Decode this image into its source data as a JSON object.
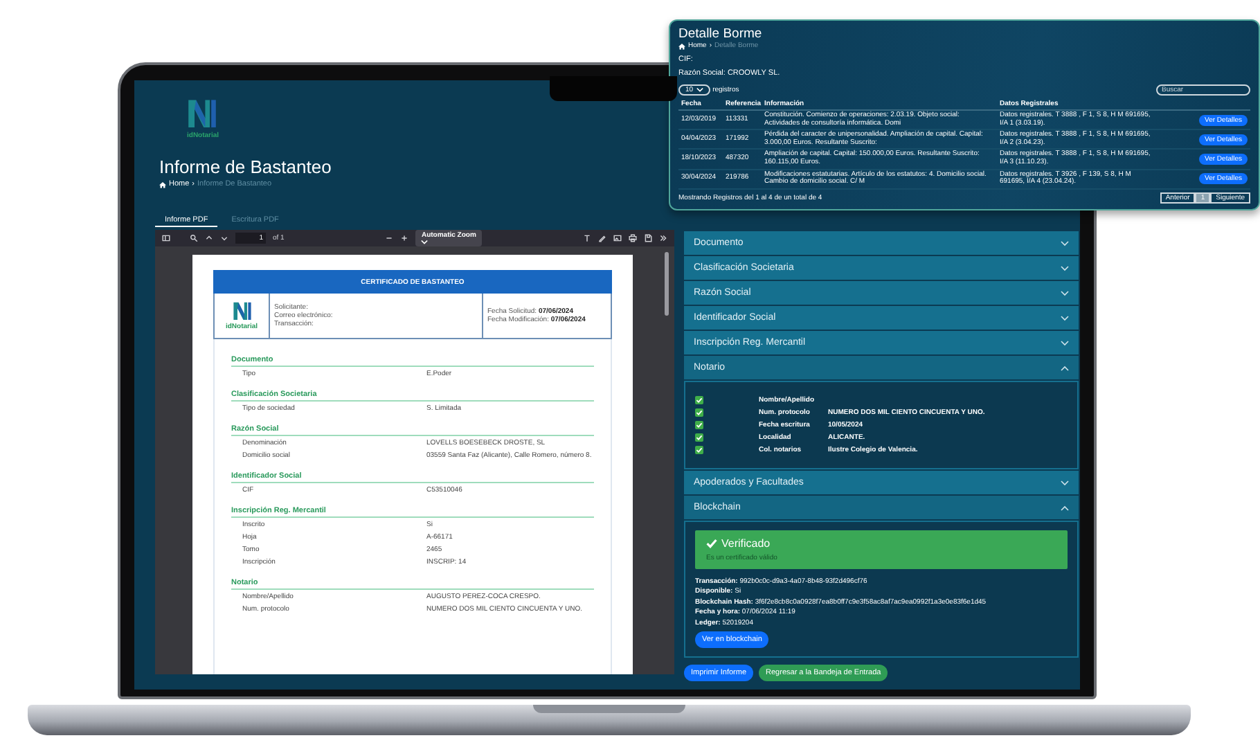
{
  "app": {
    "logo_text": "idNotarial",
    "title": "Informe de Bastanteo",
    "breadcrumb": {
      "home": "Home",
      "separator": "›",
      "current": "Informe De Bastanteo"
    },
    "tabs": [
      {
        "label": "Informe PDF",
        "selected": true
      },
      {
        "label": "Escritura PDF",
        "selected": false
      }
    ],
    "pdf_viewer": {
      "page": "1",
      "page_count": "of 1",
      "zoom": "Automatic Zoom",
      "document": {
        "heading": "CERTIFICADO DE BASTANTEO",
        "logo_text": "idNotarial",
        "fields": [
          "Solicitante:",
          "Correo electrónico:",
          "Transacción:"
        ],
        "dates": [
          {
            "label": "Fecha Solicitud:",
            "value": "07/06/2024"
          },
          {
            "label": "Fecha Modificación:",
            "value": "07/06/2024"
          }
        ],
        "sections": [
          {
            "title": "Documento",
            "rows": [
              {
                "label": "Tipo",
                "value": "E.Poder"
              }
            ]
          },
          {
            "title": "Clasificación Societaria",
            "rows": [
              {
                "label": "Tipo de sociedad",
                "value": "S. Limitada"
              }
            ]
          },
          {
            "title": "Razón Social",
            "rows": [
              {
                "label": "Denominación",
                "value": "LOVELLS BOESEBECK DROSTE, SL"
              },
              {
                "label": "Domicilio social",
                "value": "03559 Santa Faz (Alicante), Calle Romero, número 8."
              }
            ]
          },
          {
            "title": "Identificador Social",
            "rows": [
              {
                "label": "CIF",
                "value": "C53510046"
              }
            ]
          },
          {
            "title": "Inscripción Reg. Mercantil",
            "rows": [
              {
                "label": "Inscrito",
                "value": "Si"
              },
              {
                "label": "Hoja",
                "value": "A-66171"
              },
              {
                "label": "Tomo",
                "value": "2465"
              },
              {
                "label": "Inscripción",
                "value": "INSCRIP: 14"
              }
            ]
          },
          {
            "title": "Notario",
            "rows": [
              {
                "label": "Nombre/Apellido",
                "value": "AUGUSTO PEREZ-COCA CRESPO."
              },
              {
                "label": "Num. protocolo",
                "value": "NUMERO DOS MIL CIENTO CINCUENTA Y UNO."
              }
            ]
          }
        ]
      }
    },
    "accordion": [
      {
        "label": "Documento",
        "expanded": false,
        "kind": "plain"
      },
      {
        "label": "Clasificación Societaria",
        "expanded": false,
        "kind": "plain"
      },
      {
        "label": "Razón Social",
        "expanded": false,
        "kind": "plain"
      },
      {
        "label": "Identificador Social",
        "expanded": false,
        "kind": "plain"
      },
      {
        "label": "Inscripción Reg. Mercantil",
        "expanded": false,
        "kind": "plain"
      },
      {
        "label": "Notario",
        "expanded": true,
        "kind": "checklist",
        "rows": [
          {
            "checked": true,
            "label": "Nombre/Apellido"
          },
          {
            "checked": true,
            "label": "Num. protocolo",
            "value": "NUMERO DOS MIL CIENTO CINCUENTA Y UNO."
          },
          {
            "checked": true,
            "label": "Fecha escritura",
            "value": "10/05/2024"
          },
          {
            "checked": true,
            "label": "Localidad",
            "value": "ALICANTE."
          },
          {
            "checked": true,
            "label": "Col. notarios",
            "value": "Ilustre Colegio de Valencia."
          }
        ]
      },
      {
        "label": "Apoderados y Facultades",
        "expanded": false,
        "kind": "plain"
      },
      {
        "label": "Blockchain",
        "expanded": true,
        "kind": "blockchain",
        "status": {
          "title": "Verificado",
          "subtitle": "Es un certificado válido"
        },
        "details": [
          {
            "label": "Transacción:",
            "value": "992b0c0c-d9a3-4a07-8b48-93f2d496cf76"
          },
          {
            "label": "Disponible:",
            "value": "Si"
          },
          {
            "label": "Blockchain Hash:",
            "value": "3f6f2e8cb8c0a0928f7ea8b0ff7c9e3f58ac8af7ac9ea0992f1a3e0e83f6e1d45"
          },
          {
            "label": "Fecha y hora:",
            "value": "07/06/2024 11:19"
          },
          {
            "label": "Ledger:",
            "value": "52019204"
          }
        ],
        "button": "Ver en blockchain"
      }
    ],
    "actions": [
      {
        "label": "Imprimir Informe",
        "kind": "primary"
      },
      {
        "label": "Regresar a la Bandeja de Entrada",
        "kind": "success"
      }
    ]
  },
  "popup": {
    "title": "Detalle Borme",
    "breadcrumb": {
      "home": "Home",
      "separator": "›",
      "current": "Detalle Borme"
    },
    "cif": "CIF:",
    "razon_social": "Razón Social: CROOWLY SL.",
    "page_size": "10",
    "page_size_suffix": "registros",
    "search": {
      "placeholder": "Buscar"
    },
    "columns": [
      "Fecha",
      "Referencia",
      "Información",
      "Datos Registrales"
    ],
    "rows": [
      {
        "fecha": "12/03/2019",
        "referencia": "113331",
        "informacion": "Constitución. Comienzo de operaciones: 2.03.19. Objeto social: Actividades de consultoría informática. Domi",
        "datos": "Datos registrales. T 3888 , F 1, S 8, H M 691695, I/A 1 (3.03.19).",
        "action": "Ver Detalles"
      },
      {
        "fecha": "04/04/2023",
        "referencia": "171992",
        "informacion": "Pérdida del caracter de unipersonalidad. Ampliación de capital. Capital: 3.000,00 Euros. Resultante Suscrito:",
        "datos": "Datos registrales. T 3888 , F 1, S 8, H M 691695, I/A 2 (3.04.23).",
        "action": "Ver Detalles"
      },
      {
        "fecha": "18/10/2023",
        "referencia": "487320",
        "informacion": "Ampliación de capital. Capital: 150.000,00 Euros. Resultante Suscrito: 160.115,00 Euros.",
        "datos": "Datos registrales. T 3888 , F 1, S 8, H M 691695, I/A 3 (11.10.23).",
        "action": "Ver Detalles"
      },
      {
        "fecha": "30/04/2024",
        "referencia": "219786",
        "informacion": "Modificaciones estatutarias. Artículo de los estatutos: 4. Domicilio social. Cambio de domicilio social. C/ M",
        "datos": "Datos registrales. T 3926 , F 139, S 8, H M 691695, I/A 4 (23.04.24).",
        "action": "Ver Detalles"
      }
    ],
    "footer": "Mostrando Registros del 1 al 4 de un total de 4",
    "pagination": {
      "previous": "Anterior",
      "pages": [
        {
          "label": "1",
          "selected": true
        }
      ],
      "next": "Siguiente"
    }
  }
}
